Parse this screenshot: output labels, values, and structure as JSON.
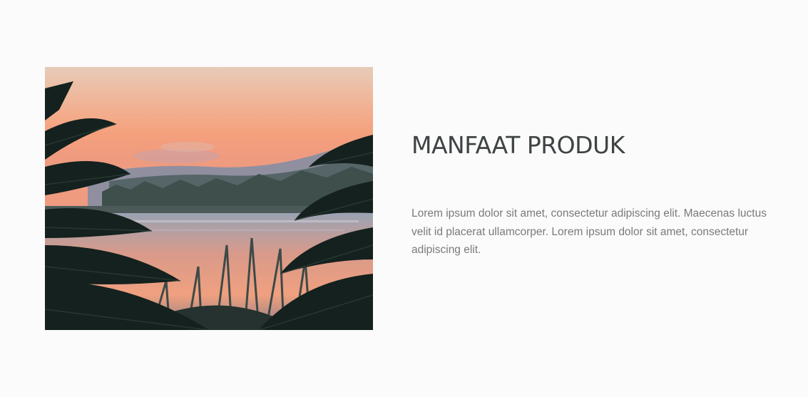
{
  "feature_section": {
    "image": {
      "alt": "sunset lake framed by palm fronds"
    },
    "title": "MANFAAT PRODUK",
    "description": "Lorem ipsum dolor sit amet, consectetur adipiscing elit. Maecenas luctus velit id placerat ullamcorper. Lorem ipsum dolor sit amet, consectetur adipiscing elit."
  },
  "colors": {
    "background": "#fbfbfb",
    "title": "#3e4344",
    "body_text": "#7a7a7a",
    "sky_top": "#e6c7b4",
    "sky_glow": "#f5a27e",
    "foliage": "#13201d"
  }
}
